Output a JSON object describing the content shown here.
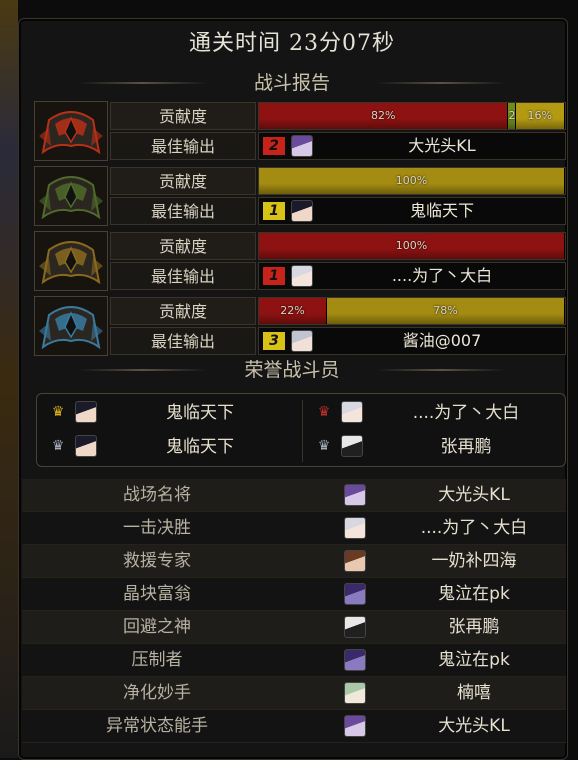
{
  "title": "通关时间   23分07秒",
  "battle_report": {
    "header": "战斗报告",
    "row_label_contribution": "贡献度",
    "row_label_best": "最佳输出",
    "teams": [
      {
        "emblem": "red-helmet-icon",
        "emblem_color": "#b83018",
        "segments": [
          {
            "label": "82%",
            "value": 82,
            "color": "#8e1212"
          },
          {
            "label": "2%",
            "value": 2,
            "color": "#6e8e1a"
          },
          {
            "label": "16%",
            "value": 16,
            "color": "#b49a12"
          }
        ],
        "rank": "2",
        "rank_color": "#c8231a",
        "player": "大光头KL",
        "avatar": "purple-hair-avatar"
      },
      {
        "emblem": "green-helmet-icon",
        "emblem_color": "#4f6a2a",
        "segments": [
          {
            "label": "100%",
            "value": 100,
            "color": "#a48c12"
          }
        ],
        "rank": "1",
        "rank_color": "#d8c218",
        "player": "鬼临天下",
        "avatar": "dark-hair-avatar"
      },
      {
        "emblem": "gold-helmet-icon",
        "emblem_color": "#8a6a1e",
        "segments": [
          {
            "label": "100%",
            "value": 100,
            "color": "#8e1212"
          }
        ],
        "rank": "1",
        "rank_color": "#c8231a",
        "player": "....为了丶大白",
        "avatar": "white-hair-avatar"
      },
      {
        "emblem": "blue-helmet-icon",
        "emblem_color": "#3a7aa0",
        "segments": [
          {
            "label": "22%",
            "value": 22,
            "color": "#8e1212"
          },
          {
            "label": "78%",
            "value": 78,
            "color": "#a48c12"
          }
        ],
        "rank": "3",
        "rank_color": "#d8c218",
        "player": "酱油@007",
        "avatar": "silver-hair-avatar"
      }
    ]
  },
  "honor": {
    "header": "荣誉战斗员",
    "entries": [
      {
        "player": "鬼临天下",
        "avatar": "dark-hair-avatar",
        "crown": "gold-crown-icon"
      },
      {
        "player": "....为了丶大白",
        "avatar": "white-hair-avatar",
        "crown": "red-crown-icon"
      },
      {
        "player": "鬼临天下",
        "avatar": "dark-hair-avatar",
        "crown": "silver-crown-icon"
      },
      {
        "player": "张再鹏",
        "avatar": "white-mask-avatar",
        "crown": "silver-crown-icon"
      }
    ]
  },
  "awards": [
    {
      "title": "战场名将",
      "player": "大光头KL",
      "avatar": "purple-hair-avatar"
    },
    {
      "title": "一击决胜",
      "player": "....为了丶大白",
      "avatar": "white-hair-avatar"
    },
    {
      "title": "救援专家",
      "player": "一奶补四海",
      "avatar": "brown-hair-avatar"
    },
    {
      "title": "晶块富翁",
      "player": "鬼泣在pk",
      "avatar": "purple-mask-avatar"
    },
    {
      "title": "回避之神",
      "player": "张再鹏",
      "avatar": "white-mask-avatar"
    },
    {
      "title": "压制者",
      "player": "鬼泣在pk",
      "avatar": "purple-mask-avatar"
    },
    {
      "title": "净化妙手",
      "player": "楠嘻",
      "avatar": "light-hair-avatar"
    },
    {
      "title": "异常状态能手",
      "player": "大光头KL",
      "avatar": "purple-hair-avatar"
    }
  ]
}
